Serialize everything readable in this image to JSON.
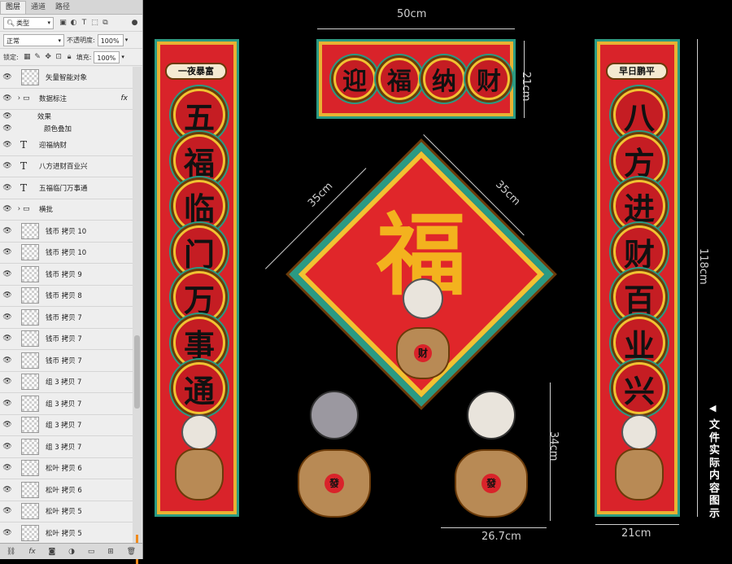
{
  "panel": {
    "tabs": [
      "图层",
      "通道",
      "路径"
    ],
    "filter": {
      "label": "类型",
      "icon": "search-icon"
    },
    "blend_mode": "正常",
    "opacity_label": "不透明度:",
    "opacity_value": "100%",
    "lock_label": "锁定:",
    "fill_label": "填充:",
    "fill_value": "100%",
    "layers": [
      {
        "name": "矢量智能对象",
        "type": "image",
        "visible": true,
        "indent": 1
      },
      {
        "name": "数据标注",
        "type": "group",
        "visible": true,
        "indent": 0,
        "fx": true
      },
      {
        "name": "效果",
        "type": "effect",
        "visible": true,
        "indent": 2
      },
      {
        "name": "颜色叠加",
        "type": "effect",
        "visible": true,
        "indent": 3
      },
      {
        "name": "迎福纳财",
        "type": "text",
        "visible": true,
        "indent": 0
      },
      {
        "name": "八方进财百业兴",
        "type": "text",
        "visible": true,
        "indent": 0
      },
      {
        "name": "五福临门万事通",
        "type": "text",
        "visible": true,
        "indent": 0
      },
      {
        "name": "横批",
        "type": "group",
        "visible": true,
        "indent": 0
      },
      {
        "name": "钱币 拷贝 10",
        "type": "image",
        "visible": true,
        "indent": 1
      },
      {
        "name": "钱币 拷贝 10",
        "type": "image",
        "visible": true,
        "indent": 1
      },
      {
        "name": "钱币 拷贝 9",
        "type": "image",
        "visible": true,
        "indent": 1
      },
      {
        "name": "钱币 拷贝 8",
        "type": "image",
        "visible": true,
        "indent": 1
      },
      {
        "name": "钱币 拷贝 7",
        "type": "image",
        "visible": true,
        "indent": 1
      },
      {
        "name": "钱币 拷贝 7",
        "type": "image",
        "visible": true,
        "indent": 1
      },
      {
        "name": "钱币 拷贝 7",
        "type": "image",
        "visible": true,
        "indent": 1
      },
      {
        "name": "组 3 拷贝 7",
        "type": "image",
        "visible": true,
        "indent": 1
      },
      {
        "name": "组 3 拷贝 7",
        "type": "image",
        "visible": true,
        "indent": 1
      },
      {
        "name": "组 3 拷贝 7",
        "type": "image",
        "visible": true,
        "indent": 1
      },
      {
        "name": "组 3 拷贝 7",
        "type": "image",
        "visible": true,
        "indent": 1
      },
      {
        "name": "松叶 拷贝 6",
        "type": "image",
        "visible": true,
        "indent": 1
      },
      {
        "name": "松叶 拷贝 6",
        "type": "image",
        "visible": true,
        "indent": 1
      },
      {
        "name": "松叶 拷贝 5",
        "type": "image",
        "visible": true,
        "indent": 1
      },
      {
        "name": "松叶 拷贝 5",
        "type": "image",
        "visible": true,
        "indent": 1
      }
    ],
    "bottom_icons": [
      "link-icon",
      "fx-icon",
      "mask-icon",
      "adjustment-icon",
      "folder-icon",
      "new-layer-icon",
      "trash-icon"
    ],
    "bottom_fx": "fx"
  },
  "canvas": {
    "banner": {
      "text": "迎福纳财",
      "width": "50cm",
      "height": "21cm"
    },
    "left_couplet": {
      "plaque": "一夜暴富",
      "text": "五福临门万事通"
    },
    "right_couplet": {
      "plaque": "早日鹏平",
      "text": "八方进财百业兴",
      "width": "21cm",
      "height": "118cm"
    },
    "diamond": {
      "character": "福",
      "side_left": "35cm",
      "side_right": "35cm",
      "bag_label": "财"
    },
    "rabbit_dims": {
      "height": "34cm",
      "width": "26.7cm"
    },
    "bag_label": "發",
    "note": "文件实际内容图示"
  },
  "colors": {
    "red": "#d9232a",
    "teal": "#2a9a83",
    "gold": "#f1c232",
    "brown": "#6b3b0a"
  }
}
